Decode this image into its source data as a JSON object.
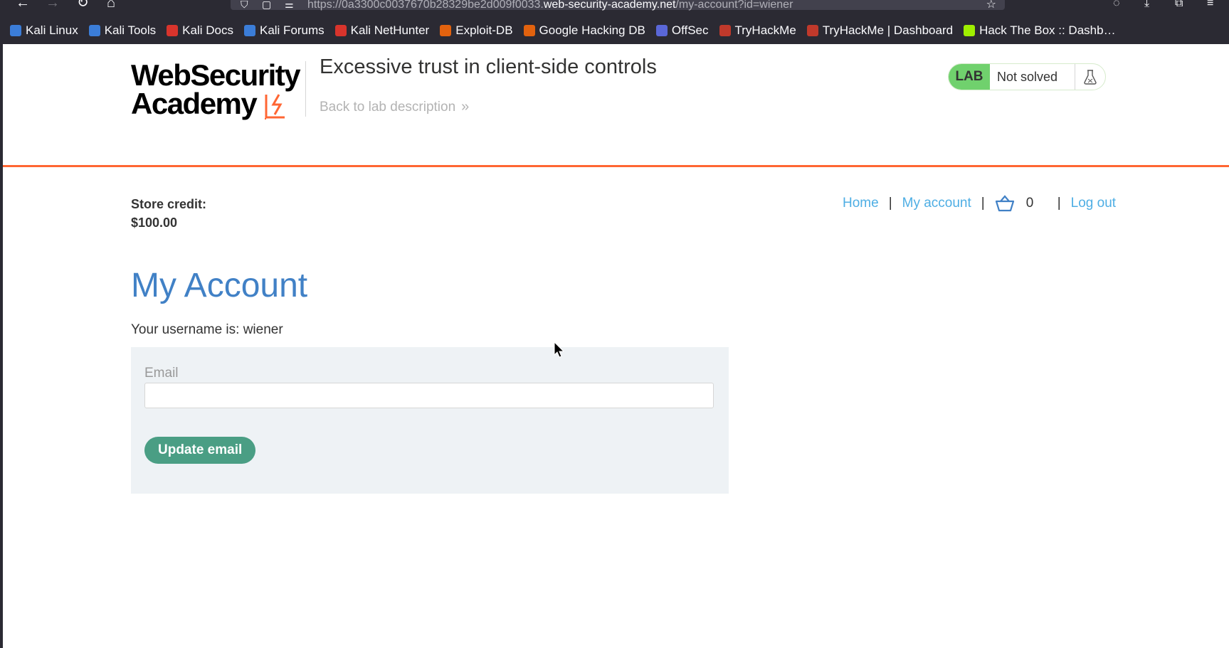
{
  "browser": {
    "url_prefix": "https://0a3300c0037670b28329be2d009f0033.",
    "url_host": "web-security-academy.net",
    "url_path": "/my-account?id=wiener",
    "bookmarks": [
      {
        "label": "Kali Linux",
        "color": "#3b7dd8"
      },
      {
        "label": "Kali Tools",
        "color": "#3b7dd8"
      },
      {
        "label": "Kali Docs",
        "color": "#d8342c"
      },
      {
        "label": "Kali Forums",
        "color": "#3b7dd8"
      },
      {
        "label": "Kali NetHunter",
        "color": "#d8342c"
      },
      {
        "label": "Exploit-DB",
        "color": "#e2620e"
      },
      {
        "label": "Google Hacking DB",
        "color": "#e2620e"
      },
      {
        "label": "OffSec",
        "color": "#5a67d8"
      },
      {
        "label": "TryHackMe",
        "color": "#c0392b"
      },
      {
        "label": "TryHackMe | Dashboard",
        "color": "#c0392b"
      },
      {
        "label": "Hack The Box :: Dashb…",
        "color": "#9fef00"
      }
    ]
  },
  "header": {
    "logo_line1": "WebSecurity",
    "logo_line2": "Academy",
    "lab_title": "Excessive trust in client-side controls",
    "back_link": "Back to lab description",
    "status_tag": "LAB",
    "status_text": "Not solved"
  },
  "account": {
    "credit_label": "Store credit:",
    "credit_value": "$100.00",
    "nav": {
      "home": "Home",
      "my_account": "My account",
      "cart_count": "0",
      "logout": "Log out"
    },
    "heading": "My Account",
    "username_text": "Your username is: wiener",
    "email_label": "Email",
    "email_value": "",
    "update_button": "Update email"
  },
  "colors": {
    "accent_orange": "#ff6633",
    "link_blue": "#4eaee4",
    "heading_blue": "#4181c6",
    "button_green": "#4a9e84",
    "lab_green": "#70d16d"
  }
}
